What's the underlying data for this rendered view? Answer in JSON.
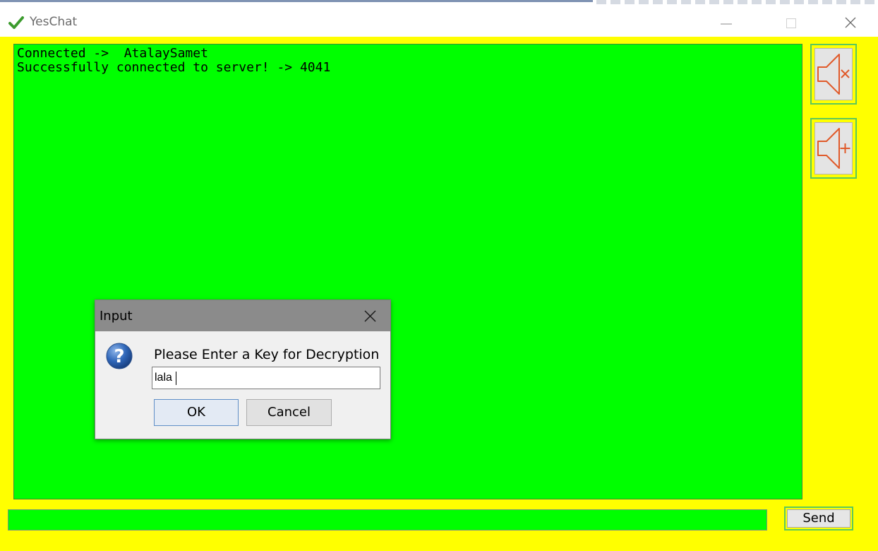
{
  "window": {
    "title": "YesChat",
    "app_icon": "checkmark-icon"
  },
  "title_controls": [
    "minimize-icon",
    "maximize-icon",
    "close-icon"
  ],
  "chat": {
    "lines": [
      "Connected ->  AtalaySamet",
      "Successfully connected to server! -> 4041"
    ]
  },
  "side_buttons": [
    {
      "icon": "speaker-mute-icon"
    },
    {
      "icon": "speaker-add-icon"
    }
  ],
  "message_input": {
    "value": ""
  },
  "send_button": {
    "label": "Send"
  },
  "dialog": {
    "title": "Input",
    "icon": "question-icon",
    "prompt": "Please Enter a Key for Decryption",
    "input_value": "lala",
    "ok_label": "OK",
    "cancel_label": "Cancel"
  },
  "colors": {
    "window_background": "#ffff00",
    "chat_background": "#00ff00",
    "speaker_icon": "#e05a2a",
    "dialog_titlebar": "#8b8b8b"
  }
}
